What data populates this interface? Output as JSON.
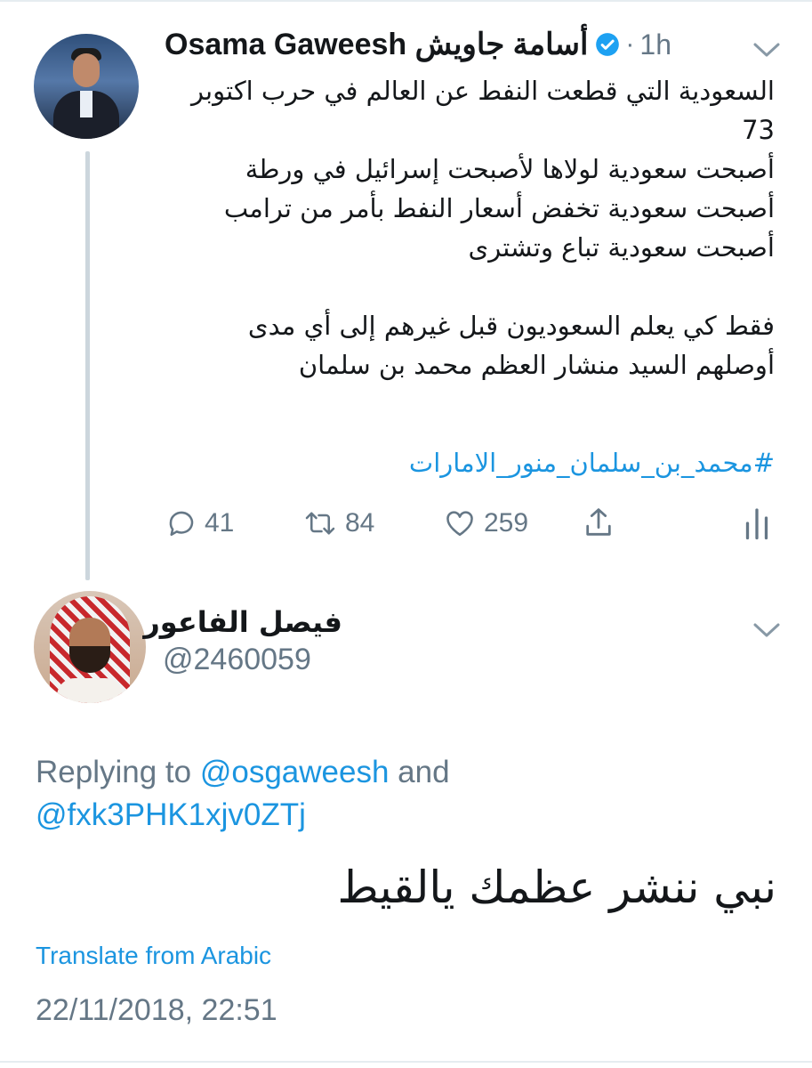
{
  "colors": {
    "link": "#1b95e0",
    "secondary_text": "#657786",
    "primary_text": "#14171a",
    "thread_line": "#ccd6dd"
  },
  "original_tweet": {
    "author_name": "Osama Gaweesh أسامة جاويش",
    "verified_icon": "verified-badge-icon",
    "separator": "·",
    "time": "1h",
    "lines": [
      "السعودية التي قطعت النفط عن العالم في حرب اكتوبر",
      "73",
      "أصبحت سعودية لولاها لأصبحت إسرائيل في ورطة",
      "أصبحت سعودية تخفض أسعار النفط بأمر من ترامب",
      "أصبحت سعودية تباع وتشترى",
      "فقط كي يعلم السعوديون قبل غيرهم إلى أي مدى",
      "أوصلهم السيد منشار العظم محمد بن سلمان"
    ],
    "hashtag": "#محمد_بن_سلمان_منور_الامارات",
    "actions": {
      "reply": {
        "icon": "reply-icon",
        "count": "41"
      },
      "retweet": {
        "icon": "retweet-icon",
        "count": "84"
      },
      "like": {
        "icon": "heart-icon",
        "count": "259"
      },
      "share": {
        "icon": "share-icon"
      },
      "analytics": {
        "icon": "analytics-icon"
      }
    }
  },
  "reply_tweet": {
    "author_name": "فيصل الفاعور",
    "handle": "@2460059",
    "replying_prefix": "Replying to ",
    "mention_1": "@osgaweesh",
    "joiner": " and ",
    "mention_2": "@fxk3PHK1xjv0ZTj",
    "text": "نبي ننشر عظمك يالقيط",
    "translate_label": "Translate from Arabic",
    "timestamp": "22/11/2018, 22:51"
  }
}
